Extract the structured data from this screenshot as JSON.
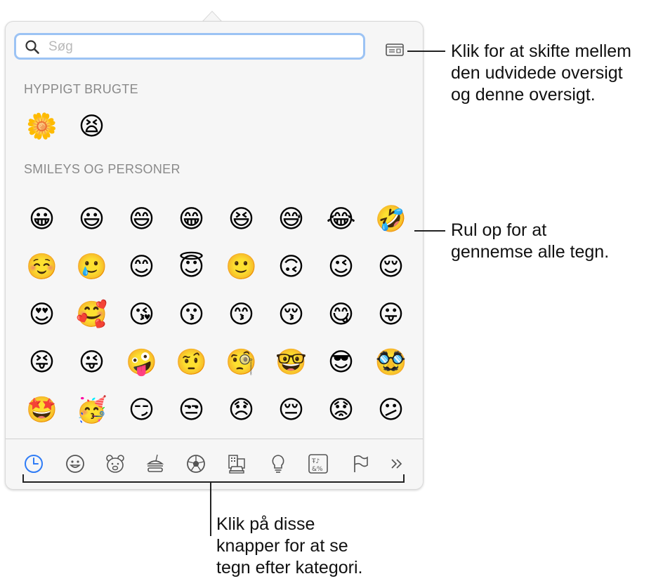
{
  "search": {
    "placeholder": "Søg",
    "value": ""
  },
  "sections": {
    "frequent": {
      "title": "HYPPIGT BRUGTE",
      "emojis": [
        "🌼",
        "😫"
      ]
    },
    "smileys": {
      "title": "SMILEYS OG PERSONER",
      "emojis": [
        "😀",
        "😃",
        "😄",
        "😁",
        "😆",
        "😅",
        "😂",
        "🤣",
        "☺️",
        "🥲",
        "😊",
        "😇",
        "🙂",
        "🙃",
        "😉",
        "😌",
        "😍",
        "🥰",
        "😘",
        "😗",
        "😙",
        "😚",
        "😋",
        "😛",
        "😝",
        "😜",
        "🤪",
        "🤨",
        "🧐",
        "🤓",
        "😎",
        "🥸",
        "🤩",
        "🥳",
        "😏",
        "😒",
        "😞",
        "😔",
        "😟",
        "😕",
        "🙁",
        "☹️",
        "😣",
        "😖",
        "😫",
        "😩",
        "🥺",
        "😢"
      ]
    }
  },
  "categories": [
    {
      "name": "frequently-used",
      "icon": "clock-icon",
      "active": true
    },
    {
      "name": "smileys-people",
      "icon": "smiley-icon"
    },
    {
      "name": "animals-nature",
      "icon": "bear-icon"
    },
    {
      "name": "food-drink",
      "icon": "burger-icon"
    },
    {
      "name": "activity",
      "icon": "soccer-ball-icon"
    },
    {
      "name": "travel-places",
      "icon": "building-car-icon"
    },
    {
      "name": "objects",
      "icon": "lightbulb-icon"
    },
    {
      "name": "symbols",
      "icon": "symbols-icon"
    },
    {
      "name": "flags",
      "icon": "flag-icon"
    },
    {
      "name": "more",
      "icon": "chevron-double-right-icon"
    }
  ],
  "callouts": {
    "toggle_view": "Klik for at skifte mellem\nden udvidede oversigt\nog denne oversigt.",
    "scroll": "Rul op for at\ngennemse alle tegn.",
    "categories": "Klik på disse\nknapper for at se\ntegn efter kategori."
  },
  "colors": {
    "accent": "#2f7cf6",
    "focus_ring": "#9cc3f4",
    "icon": "#555555"
  }
}
